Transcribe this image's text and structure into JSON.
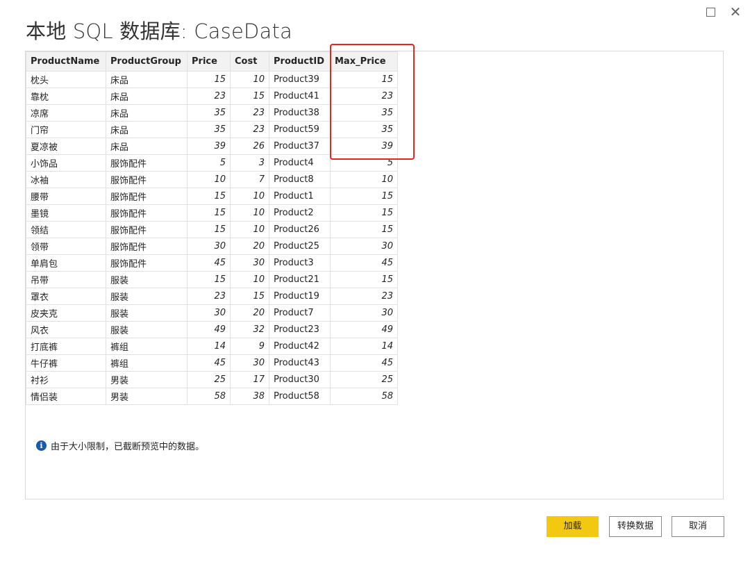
{
  "window": {
    "title": "本地 SQL 数据库: CaseData",
    "maximize_icon": "maximize-icon",
    "close_icon": "close-icon",
    "close_glyph": "✕"
  },
  "table": {
    "columns": [
      "ProductName",
      "ProductGroup",
      "Price",
      "Cost",
      "ProductID",
      "Max_Price"
    ],
    "rows": [
      [
        "枕头",
        "床品",
        "15",
        "10",
        "Product39",
        "15"
      ],
      [
        "靠枕",
        "床品",
        "23",
        "15",
        "Product41",
        "23"
      ],
      [
        "凉席",
        "床品",
        "35",
        "23",
        "Product38",
        "35"
      ],
      [
        "门帘",
        "床品",
        "35",
        "23",
        "Product59",
        "35"
      ],
      [
        "夏凉被",
        "床品",
        "39",
        "26",
        "Product37",
        "39"
      ],
      [
        "小饰品",
        "服饰配件",
        "5",
        "3",
        "Product4",
        "5"
      ],
      [
        "冰袖",
        "服饰配件",
        "10",
        "7",
        "Product8",
        "10"
      ],
      [
        "腰带",
        "服饰配件",
        "15",
        "10",
        "Product1",
        "15"
      ],
      [
        "墨镜",
        "服饰配件",
        "15",
        "10",
        "Product2",
        "15"
      ],
      [
        "领结",
        "服饰配件",
        "15",
        "10",
        "Product26",
        "15"
      ],
      [
        "领带",
        "服饰配件",
        "30",
        "20",
        "Product25",
        "30"
      ],
      [
        "单肩包",
        "服饰配件",
        "45",
        "30",
        "Product3",
        "45"
      ],
      [
        "吊带",
        "服装",
        "15",
        "10",
        "Product21",
        "15"
      ],
      [
        "罩衣",
        "服装",
        "23",
        "15",
        "Product19",
        "23"
      ],
      [
        "皮夹克",
        "服装",
        "30",
        "20",
        "Product7",
        "30"
      ],
      [
        "风衣",
        "服装",
        "49",
        "32",
        "Product23",
        "49"
      ],
      [
        "打底裤",
        "裤组",
        "14",
        "9",
        "Product42",
        "14"
      ],
      [
        "牛仔裤",
        "裤组",
        "45",
        "30",
        "Product43",
        "45"
      ],
      [
        "衬衫",
        "男装",
        "25",
        "17",
        "Product30",
        "25"
      ],
      [
        "情侣装",
        "男装",
        "58",
        "38",
        "Product58",
        "58"
      ]
    ],
    "numeric_columns": [
      2,
      3,
      5
    ]
  },
  "annotation": {
    "highlight_color": "#e8231a"
  },
  "notice": {
    "icon": "info-icon",
    "icon_glyph": "i",
    "text": "由于大小限制，已截断预览中的数据。"
  },
  "buttons": {
    "load": "加载",
    "transform": "转换数据",
    "cancel": "取消"
  },
  "colors": {
    "primary_button": "#f2c811",
    "info_icon": "#1b5aa8"
  }
}
